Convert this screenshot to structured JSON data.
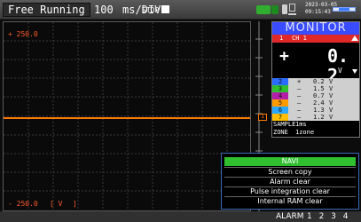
{
  "status_bar": {
    "mode": "Free Running",
    "time_div_value": "100",
    "time_div_unit": "ms/DIV",
    "run_state": "STOP",
    "date": "2023-03-05",
    "time": "09:15:43"
  },
  "plot": {
    "y_top_label": "+ 250.0",
    "y_bottom_label": "- 250.0",
    "unit_label": "[ V",
    "bracket_close": "]",
    "trace_color": "#ff7a00",
    "channel_marker": "1"
  },
  "monitor": {
    "title": "MONITOR",
    "ch1": {
      "num": "1",
      "label": "CH 1"
    },
    "big_sign": "+",
    "big_value": "0. 2",
    "big_unit": "V",
    "channels": [
      {
        "num": "2",
        "color": "#2a6cff",
        "sign": "+",
        "value": "0.2",
        "unit": "V"
      },
      {
        "num": "3",
        "color": "#2fbf2f",
        "sign": "–",
        "value": "1.5",
        "unit": "V"
      },
      {
        "num": "4",
        "color": "#b31ea8",
        "sign": "–",
        "value": "0.7",
        "unit": "V"
      },
      {
        "num": "5",
        "color": "#ff9a00",
        "sign": "–",
        "value": "2.4",
        "unit": "V"
      },
      {
        "num": "6",
        "color": "#2aa8ff",
        "sign": "–",
        "value": "1.3",
        "unit": "V"
      },
      {
        "num": "7",
        "color": "#ffbf00",
        "sign": "–",
        "value": "1.2",
        "unit": "V"
      },
      {
        "num": "8",
        "color": "#e0288e",
        "sign": "+",
        "value": "0.4",
        "unit": "V"
      }
    ],
    "sample_label": "SAMPLE",
    "sample_value": "1ms",
    "zone_label": "ZONE",
    "zone_value": "1zone"
  },
  "navi": {
    "title": "NAVI",
    "items": [
      "Screen copy",
      "Alarm clear",
      "Pulse integration clear",
      "Internal RAM clear"
    ]
  },
  "alarm": {
    "label": "ALARM",
    "numbers": "1 2 3 4"
  }
}
